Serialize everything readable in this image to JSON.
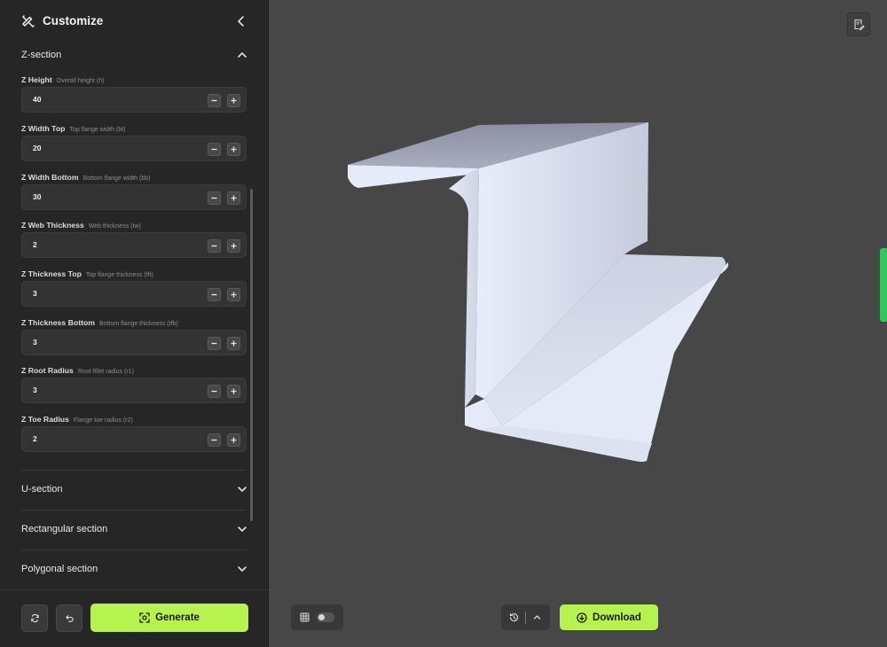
{
  "sidebar": {
    "title": "Customize",
    "sections": {
      "z": {
        "label": "Z-section",
        "expanded": true
      },
      "u": {
        "label": "U-section",
        "expanded": false
      },
      "rect": {
        "label": "Rectangular section",
        "expanded": false
      },
      "poly": {
        "label": "Polygonal section",
        "expanded": false
      }
    },
    "params": [
      {
        "name": "Z Height",
        "desc": "Overall height (h)",
        "value": "40"
      },
      {
        "name": "Z Width Top",
        "desc": "Top flange width (bt)",
        "value": "20"
      },
      {
        "name": "Z Width Bottom",
        "desc": "Bottom flange width (bb)",
        "value": "30"
      },
      {
        "name": "Z Web Thickness",
        "desc": "Web thickness (tw)",
        "value": "2"
      },
      {
        "name": "Z Thickness Top",
        "desc": "Top flange thickness (tft)",
        "value": "3"
      },
      {
        "name": "Z Thickness Bottom",
        "desc": "Bottom flange thickness (tfb)",
        "value": "3"
      },
      {
        "name": "Z Root Radius",
        "desc": "Root fillet radius (r1)",
        "value": "3"
      },
      {
        "name": "Z Toe Radius",
        "desc": "Flange toe radius (r2)",
        "value": "2"
      }
    ],
    "footer": {
      "generate_label": "Generate"
    }
  },
  "viewport": {
    "download_label": "Download",
    "grid_toggle_on": false
  },
  "colors": {
    "accent": "#b7f34f",
    "sidebar_bg": "#262626",
    "viewport_bg": "#474747",
    "side_tab": "#2ec95a"
  },
  "icons": {
    "title": "pencil-ruler-icon",
    "collapse": "chevron-left-icon",
    "expand": "chevron-down-icon",
    "collapse_section": "chevron-up-icon",
    "reset": "refresh-icon",
    "undo": "undo-icon",
    "generate": "scan-icon",
    "grid": "grid-icon",
    "history": "history-icon",
    "download": "download-circle-icon",
    "notes": "notes-icon"
  }
}
